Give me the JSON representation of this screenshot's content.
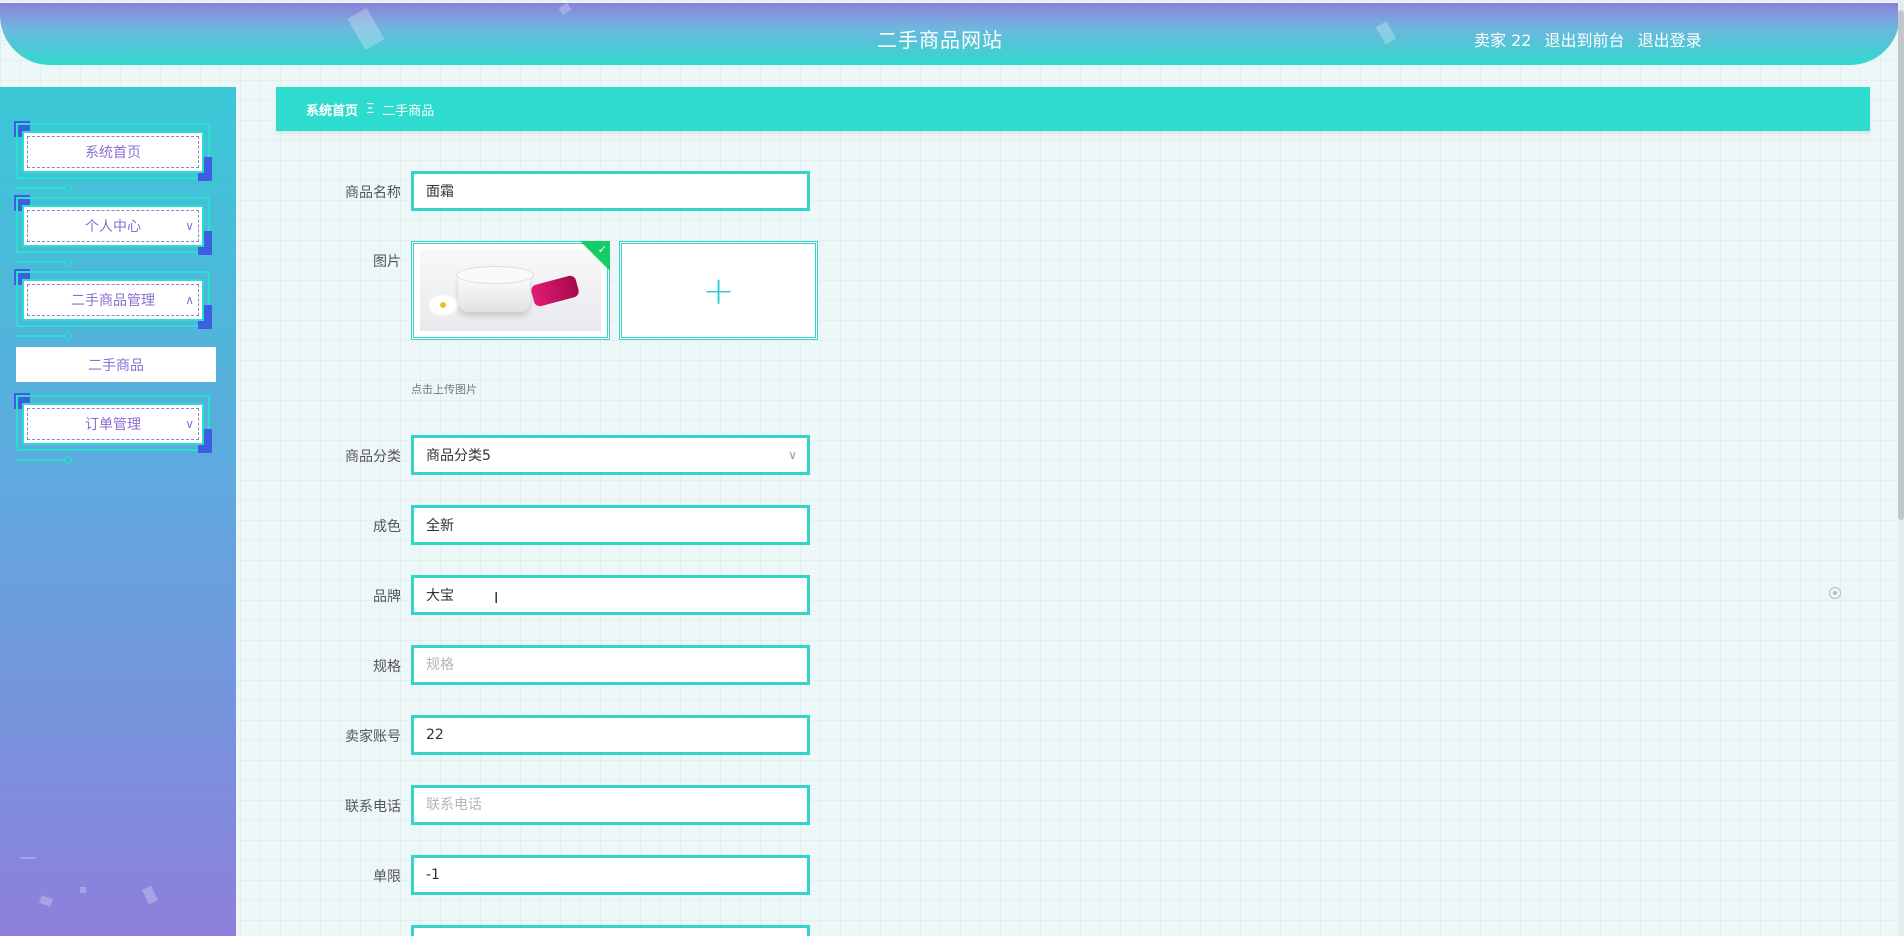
{
  "header": {
    "site_title": "二手商品网站",
    "user_label": "卖家 22",
    "back_to_front": "退出到前台",
    "logout": "退出登录"
  },
  "sidebar": {
    "items": [
      {
        "label": "系统首页"
      },
      {
        "label": "个人中心",
        "chevron": "chevron-down-icon"
      },
      {
        "label": "二手商品管理",
        "chevron": "chevron-up-icon"
      },
      {
        "label": "订单管理",
        "chevron": "chevron-down-icon"
      }
    ],
    "sub_item": "二手商品"
  },
  "breadcrumb": {
    "home": "系统首页",
    "separator": "Ξ",
    "current": "二手商品"
  },
  "form": {
    "name": {
      "label": "商品名称",
      "value": "面霜"
    },
    "image": {
      "label": "图片",
      "hint": "点击上传图片",
      "add_icon": "plus-icon"
    },
    "category": {
      "label": "商品分类",
      "value": "商品分类5"
    },
    "condition": {
      "label": "成色",
      "value": "全新"
    },
    "brand": {
      "label": "品牌",
      "value": "大宝"
    },
    "spec": {
      "label": "规格",
      "value": "",
      "placeholder": "规格"
    },
    "seller": {
      "label": "卖家账号",
      "value": "22"
    },
    "phone": {
      "label": "联系电话",
      "value": "",
      "placeholder": "联系电话"
    },
    "limit": {
      "label": "单限",
      "value": "-1"
    }
  },
  "colors": {
    "accent": "#2edccf",
    "sidebar_top": "#3ac8d6",
    "sidebar_bottom": "#8e7fdb",
    "menu_text": "#8a6fd0"
  }
}
